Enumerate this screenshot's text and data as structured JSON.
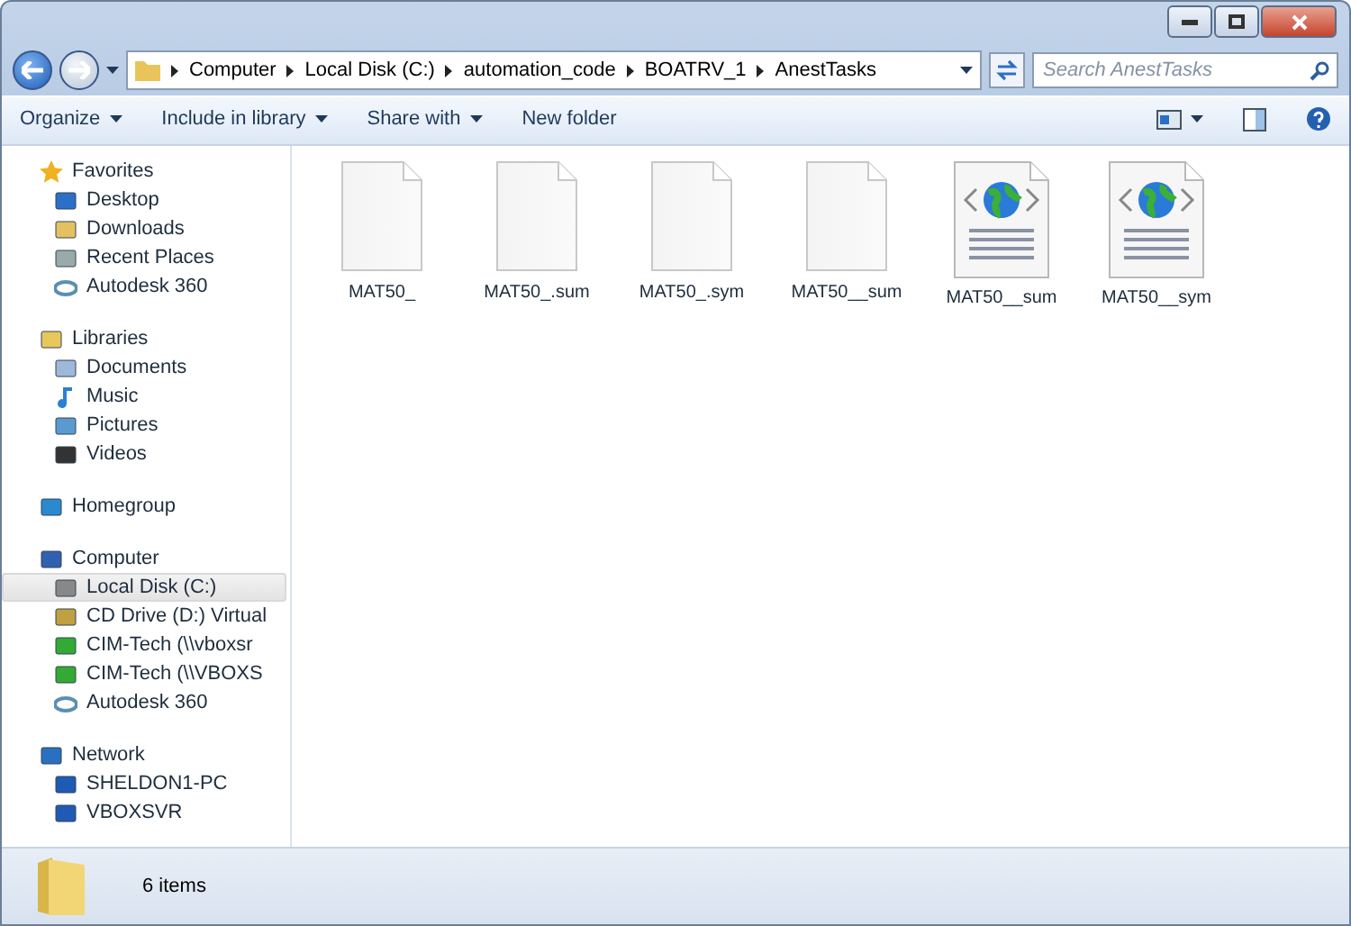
{
  "address": {
    "crumbs": [
      "Computer",
      "Local Disk (C:)",
      "automation_code",
      "BOATRV_1",
      "AnestTasks"
    ]
  },
  "search": {
    "placeholder": "Search AnestTasks"
  },
  "toolbar": {
    "menus": [
      "Organize",
      "Include in library",
      "Share with"
    ],
    "buttons": [
      "New folder"
    ]
  },
  "sidebar": {
    "sections": [
      {
        "label": "Favorites",
        "kind": "star",
        "items": [
          {
            "label": "Desktop",
            "kind": "desktop",
            "selected": false
          },
          {
            "label": "Downloads",
            "kind": "download",
            "selected": false
          },
          {
            "label": "Recent Places",
            "kind": "recent",
            "selected": false
          },
          {
            "label": "Autodesk 360",
            "kind": "cloud",
            "selected": false
          }
        ]
      },
      {
        "label": "Libraries",
        "kind": "library",
        "items": [
          {
            "label": "Documents",
            "kind": "document",
            "selected": false
          },
          {
            "label": "Music",
            "kind": "music",
            "selected": false
          },
          {
            "label": "Pictures",
            "kind": "picture",
            "selected": false
          },
          {
            "label": "Videos",
            "kind": "video",
            "selected": false
          }
        ]
      },
      {
        "label": "Homegroup",
        "kind": "homegroup"
      },
      {
        "label": "Computer",
        "kind": "computer",
        "items": [
          {
            "label": "Local Disk (C:)",
            "kind": "disk",
            "selected": true
          },
          {
            "label": "CD Drive (D:) Virtual",
            "kind": "cd",
            "selected": false
          },
          {
            "label": "CIM-Tech (\\\\vboxsr",
            "kind": "share",
            "selected": false
          },
          {
            "label": "CIM-Tech (\\\\VBOXS",
            "kind": "share",
            "selected": false
          },
          {
            "label": "Autodesk 360",
            "kind": "cloud",
            "selected": false
          }
        ]
      },
      {
        "label": "Network",
        "kind": "network",
        "items": [
          {
            "label": "SHELDON1-PC",
            "kind": "pc",
            "selected": false
          },
          {
            "label": "VBOXSVR",
            "kind": "pc",
            "selected": false
          }
        ]
      }
    ]
  },
  "files": [
    {
      "name": "MAT50_",
      "kind": "blank"
    },
    {
      "name": "MAT50_.sum",
      "kind": "blank"
    },
    {
      "name": "MAT50_.sym",
      "kind": "blank"
    },
    {
      "name": "MAT50__sum",
      "kind": "blank"
    },
    {
      "name": "MAT50__sum",
      "kind": "web"
    },
    {
      "name": "MAT50__sym",
      "kind": "web"
    }
  ],
  "status_bar": {
    "count": "6 items"
  }
}
